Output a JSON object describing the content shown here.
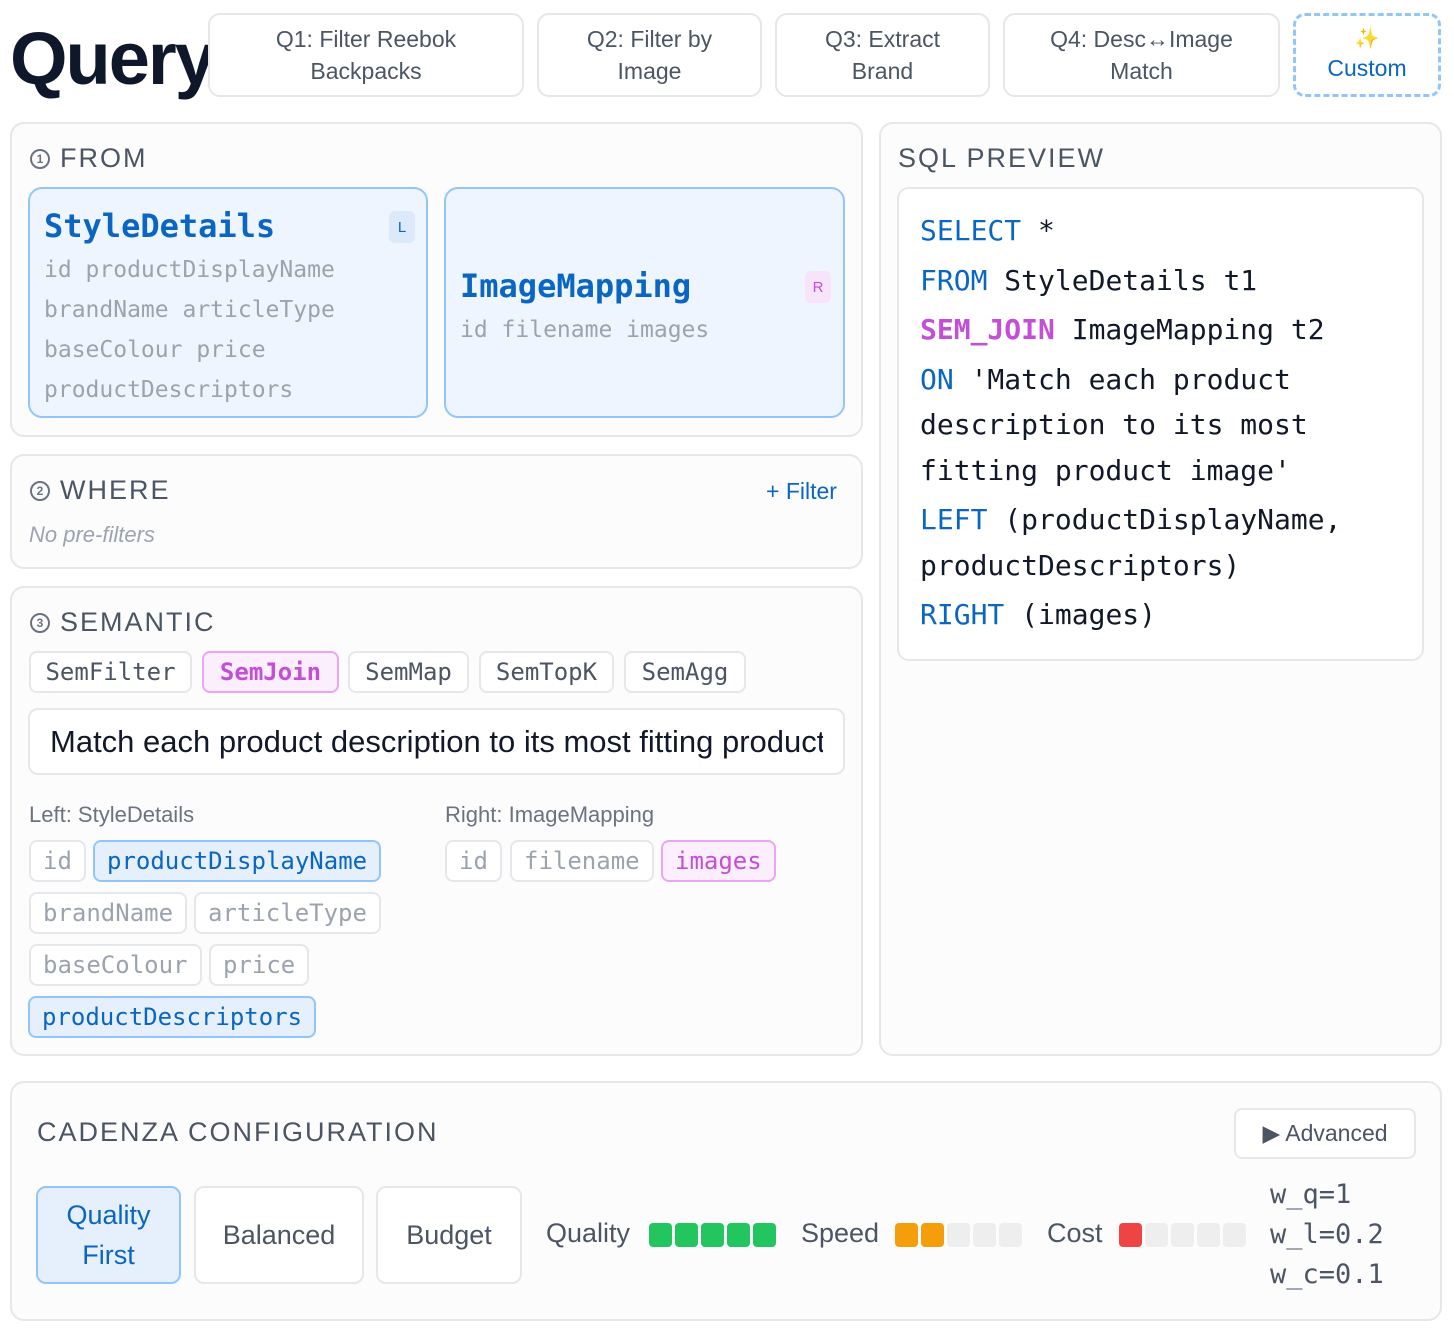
{
  "header": {
    "title": "Query",
    "presets": [
      {
        "line1": "Q1: Filter Reebok",
        "line2": "Backpacks"
      },
      {
        "line1": "Q2: Filter by",
        "line2": "Image"
      },
      {
        "line1": "Q3: Extract",
        "line2": "Brand"
      },
      {
        "line1": "Q4: Desc↔Image",
        "line2": "Match"
      }
    ],
    "custom": {
      "icon": "✨",
      "label": "Custom"
    }
  },
  "from": {
    "number": "1",
    "title": "FROM",
    "left": {
      "name": "StyleDetails",
      "badge": "L",
      "columns": [
        "id productDisplayName",
        "brandName articleType",
        "baseColour price",
        "productDescriptors"
      ]
    },
    "right": {
      "name": "ImageMapping",
      "badge": "R",
      "columns": [
        "id filename images"
      ]
    }
  },
  "where": {
    "number": "2",
    "title": "WHERE",
    "add_filter": "+ Filter",
    "empty": "No pre-filters"
  },
  "semantic": {
    "number": "3",
    "title": "SEMANTIC",
    "ops": [
      "SemFilter",
      "SemJoin",
      "SemMap",
      "SemTopK",
      "SemAgg"
    ],
    "active_op": "SemJoin",
    "prompt_value": "Match each product description to its most fitting product image",
    "left_label": "Left: StyleDetails",
    "right_label": "Right: ImageMapping",
    "left_cols": [
      "id",
      "productDisplayName",
      "brandName",
      "articleType",
      "baseColour",
      "price",
      "productDescriptors"
    ],
    "left_selected": [
      "productDisplayName",
      "productDescriptors"
    ],
    "right_cols": [
      "id",
      "filename",
      "images"
    ],
    "right_selected": [
      "images"
    ]
  },
  "sql": {
    "title": "SQL PREVIEW",
    "lines": [
      {
        "kw": "SELECT",
        "rest": " *"
      },
      {
        "kw": "FROM",
        "rest": " StyleDetails t1"
      },
      {
        "kw": "SEM_JOIN",
        "rest": " ImageMapping t2"
      },
      {
        "kw": "ON",
        "rest": " 'Match each product"
      },
      {
        "kw": "",
        "rest": "description to its most"
      },
      {
        "kw": "",
        "rest": "fitting product image'"
      },
      {
        "kw": "LEFT",
        "rest": " (productDisplayName,"
      },
      {
        "kw": "",
        "rest": "productDescriptors)"
      },
      {
        "kw": "RIGHT",
        "rest": " (images)"
      }
    ]
  },
  "cadenza": {
    "title": "CADENZA CONFIGURATION",
    "advanced": "▶ Advanced",
    "modes": [
      {
        "line1": "Quality",
        "line2": "First"
      },
      {
        "line1": "Balanced",
        "line2": ""
      },
      {
        "line1": "Budget",
        "line2": ""
      }
    ],
    "active_mode": "Quality First",
    "meters": [
      {
        "label": "Quality",
        "level": 5,
        "max": 5,
        "color": "#22c55e"
      },
      {
        "label": "Speed",
        "level": 2,
        "max": 5,
        "color": "#f59e0b"
      },
      {
        "label": "Cost",
        "level": 1,
        "max": 5,
        "color": "#ef4444"
      }
    ],
    "weights": [
      "w_q=1",
      "w_l=0.2",
      "w_c=0.1"
    ]
  },
  "colors": {
    "accent": "#0a66c2",
    "join": "#c34fd6",
    "border": "#e5e7eb"
  }
}
